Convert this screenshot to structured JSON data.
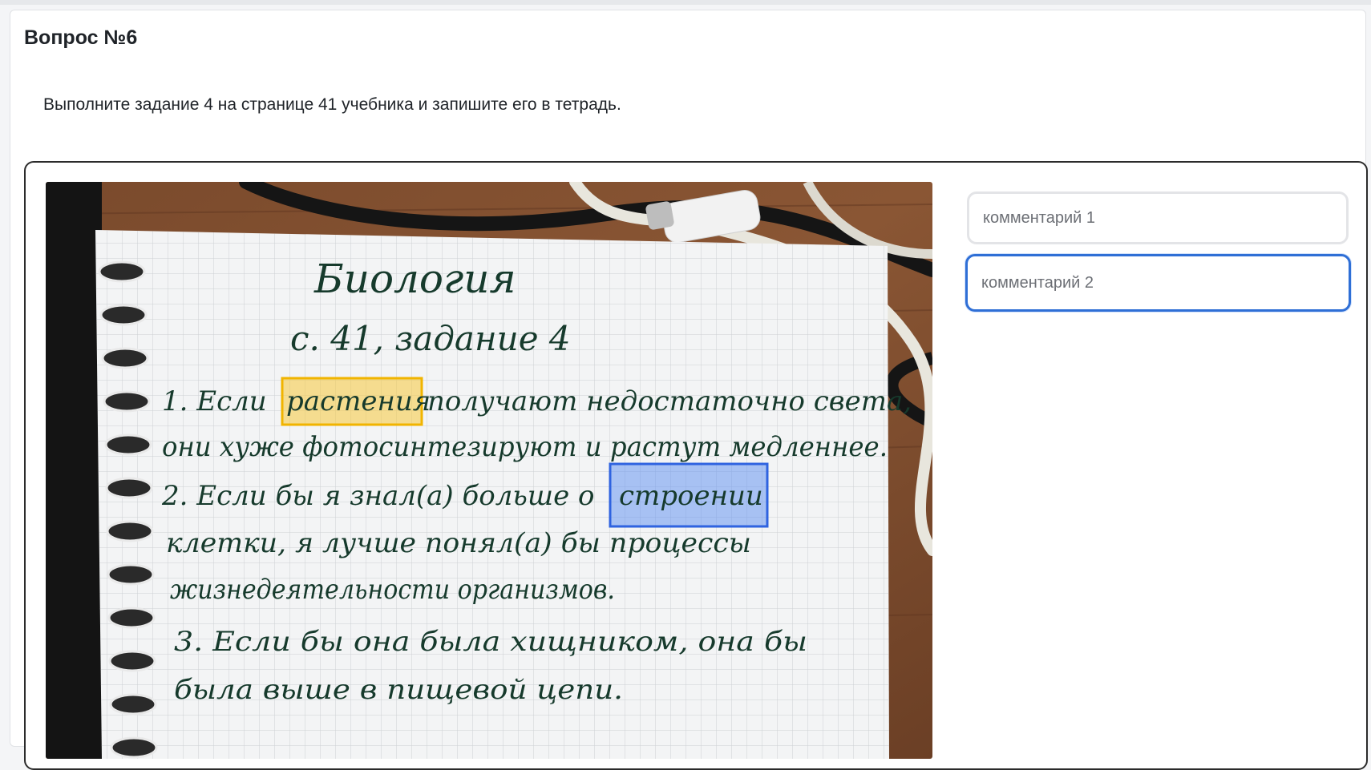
{
  "question": {
    "title": "Вопрос №6",
    "text": "Выполните задание 4 на странице 41 учебника и запишите его в тетрадь."
  },
  "notebook": {
    "heading": "Биология",
    "subheading": "с. 41, задание 4",
    "lines": [
      {
        "prefix": "1. Если",
        "highlight": "растения",
        "rest": "получают недостаточно света,"
      },
      {
        "text": "они хуже фотосинтезируют и растут медленнее."
      },
      {
        "prefix": "2. Если бы я знал(а) больше о",
        "highlight": "строении",
        "rest": ""
      },
      {
        "text": "клетки, я лучше понял(а) бы процессы"
      },
      {
        "text": "жизнедеятельности организмов."
      },
      {
        "text": "3. Если бы она была хищником, она бы"
      },
      {
        "text": "была выше в пищевой цепи."
      }
    ],
    "highlight_colors": {
      "yellow": "#f5c93a",
      "blue": "#3d6fe0"
    }
  },
  "comments": [
    {
      "placeholder": "комментарий 1",
      "value": ""
    },
    {
      "placeholder": "комментарий 2",
      "value": ""
    }
  ]
}
